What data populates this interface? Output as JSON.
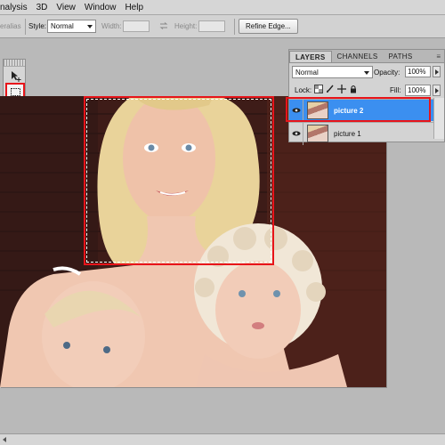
{
  "menu": {
    "items": [
      "nalysis",
      "3D",
      "View",
      "Window",
      "Help"
    ]
  },
  "options": {
    "feather_fragment": "eralias",
    "style_label": "Style:",
    "style_value": "Normal",
    "width_label": "Width:",
    "height_label": "Height:",
    "refine_edge": "Refine Edge..."
  },
  "tools": [
    "move-tool",
    "rectangular-marquee-tool",
    "lasso-tool",
    "quick-selection-tool",
    "crop-tool",
    "eyedropper-tool",
    "spot-healing-tool",
    "brush-tool",
    "clone-stamp-tool",
    "history-brush-tool",
    "eraser-tool",
    "gradient-tool",
    "blur-tool",
    "dodge-tool"
  ],
  "layers_panel": {
    "tabs": [
      "LAYERS",
      "CHANNELS",
      "PATHS"
    ],
    "active_tab": "LAYERS",
    "blend_mode": "Normal",
    "opacity_label": "Opacity:",
    "opacity_value": "100%",
    "lock_label": "Lock:",
    "fill_label": "Fill:",
    "fill_value": "100%",
    "layers": [
      {
        "name": "picture 2",
        "selected": true,
        "visible": true
      },
      {
        "name": "picture 1",
        "selected": false,
        "visible": true
      }
    ]
  },
  "colors": {
    "highlight_red": "#e8141a",
    "selected_layer_blue": "#3b8ff0",
    "panel_gray": "#d3d3d3"
  }
}
